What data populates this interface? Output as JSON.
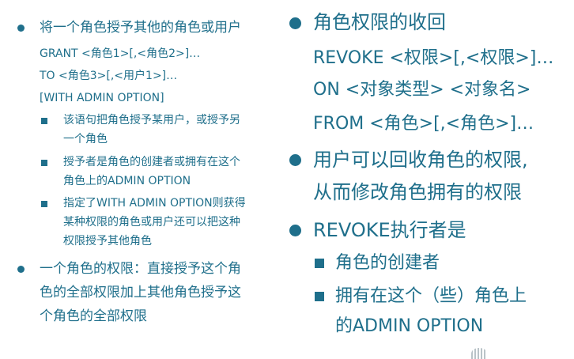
{
  "left": {
    "bullet1": "将一个角色授予其他的角色或用户",
    "code": [
      "GRANT  <角色1>[,<角色2>]…",
      "TO  <角色3>[,<用户1>]…",
      "[WITH ADMIN OPTION]"
    ],
    "sub": [
      [
        "该语句把角色授予某用户，或授予另",
        "一个角色"
      ],
      [
        "授予者是角色的创建者或拥有在这个",
        "角色上的ADMIN OPTION"
      ],
      [
        "指定了WITH ADMIN OPTION则获得",
        "某种权限的角色或用户还可以把这种",
        "权限授予其他角色"
      ]
    ],
    "bullet2": [
      "一个角色的权限：直接授予这个角",
      "色的全部权限加上其他角色授予这",
      "个角色的全部权限"
    ]
  },
  "right": {
    "bullet1": "角色权限的收回",
    "code": [
      "REVOKE <权限>[,<权限>]…",
      "ON <对象类型> <对象名>",
      "FROM <角色>[,<角色>]…"
    ],
    "bullet2": [
      "用户可以回收角色的权限,",
      "从而修改角色拥有的权限"
    ],
    "bullet3": "REVOKE执行者是",
    "sub": [
      [
        "角色的创建者"
      ],
      [
        "拥有在这个（些）角色上",
        "的ADMIN OPTION"
      ]
    ]
  }
}
